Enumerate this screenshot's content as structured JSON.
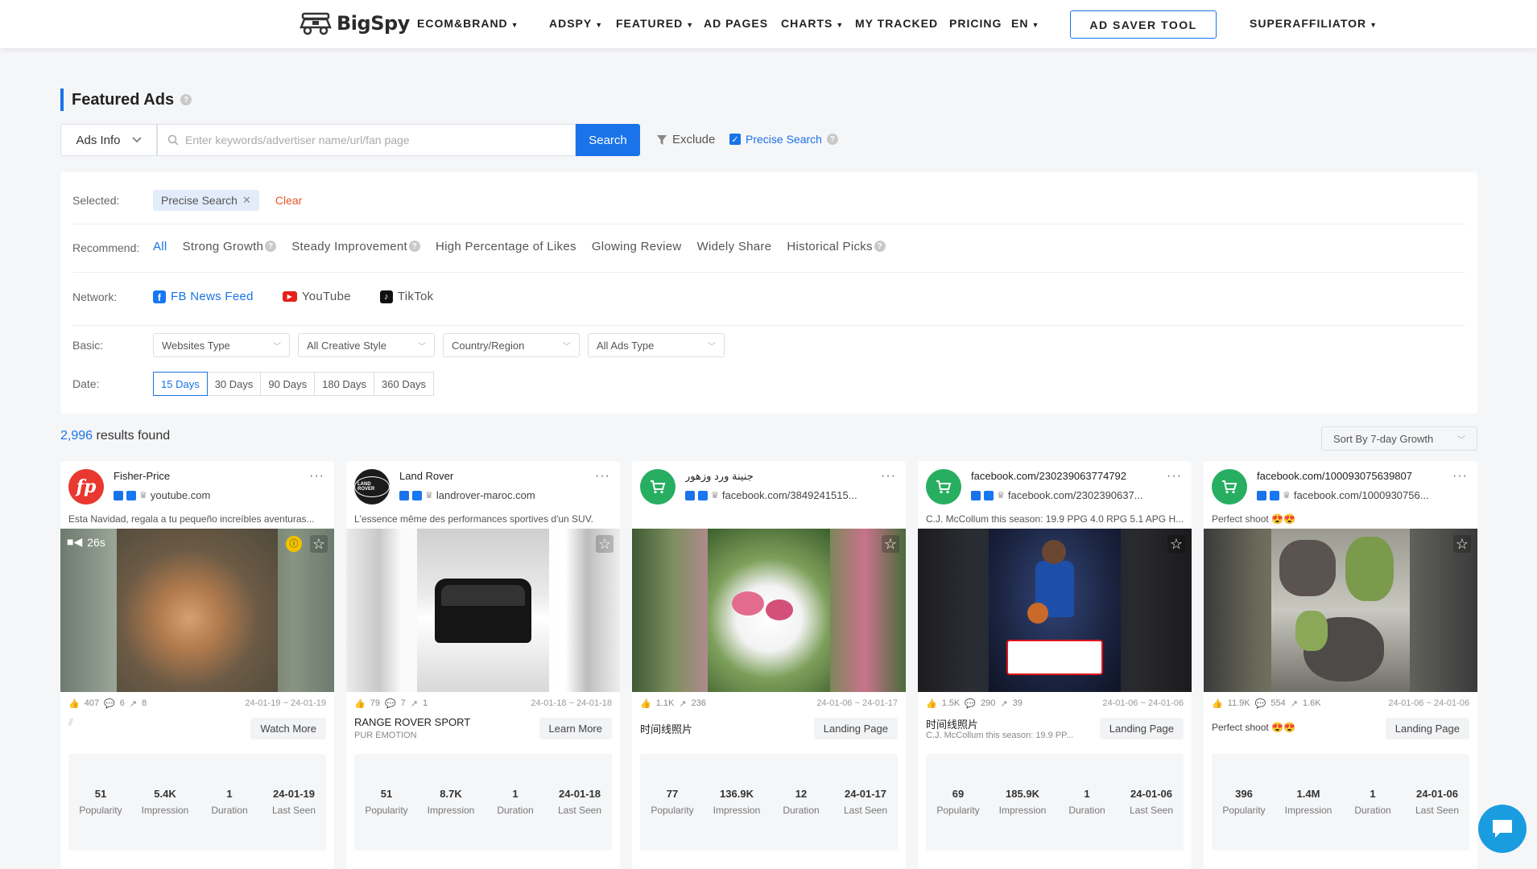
{
  "header": {
    "logo": "BigSpy",
    "nav": [
      {
        "label": "ECOM&BRAND",
        "caret": true
      },
      {
        "label": "ADSPY",
        "caret": true
      },
      {
        "label": "FEATURED",
        "caret": true
      },
      {
        "label": "AD PAGES",
        "caret": false
      },
      {
        "label": "CHARTS",
        "caret": true
      },
      {
        "label": "MY TRACKED",
        "caret": false
      },
      {
        "label": "PRICING",
        "caret": false
      },
      {
        "label": "EN",
        "caret": true
      },
      {
        "label": "SUPERAFFILIATOR",
        "caret": true
      }
    ],
    "saver_button": "AD SAVER TOOL"
  },
  "page": {
    "title": "Featured Ads"
  },
  "search": {
    "type_select": "Ads Info",
    "placeholder": "Enter keywords/advertiser name/url/fan page",
    "button": "Search",
    "exclude": "Exclude",
    "precise": "Precise Search"
  },
  "filters": {
    "selected_label": "Selected:",
    "selected_chip": "Precise Search",
    "clear": "Clear",
    "recommend_label": "Recommend:",
    "recommend": [
      "All",
      "Strong Growth",
      "Steady Improvement",
      "High Percentage of Likes",
      "Glowing Review",
      "Widely Share",
      "Historical Picks"
    ],
    "network_label": "Network:",
    "networks": [
      "FB News Feed",
      "YouTube",
      "TikTok"
    ],
    "basic_label": "Basic:",
    "basic": [
      "Websites Type",
      "All Creative Style",
      "Country/Region",
      "All Ads Type"
    ],
    "date_label": "Date:",
    "dates": [
      "15 Days",
      "30 Days",
      "90 Days",
      "180 Days",
      "360 Days"
    ]
  },
  "results": {
    "count": "2,996",
    "text": "results found",
    "sort": "Sort By 7-day Growth"
  },
  "cards": [
    {
      "name": "Fisher-Price",
      "domain": "youtube.com",
      "avatar_text": "fp",
      "avatar_color": "#e8382f",
      "desc": "Esta Navidad, regala a tu pequeño increíbles aventuras...",
      "video_duration": "26s",
      "likes": "407",
      "comments": "6",
      "shares": "8",
      "dates": "24-01-19 ~ 24-01-19",
      "headline": "",
      "sub": "",
      "cta": "Watch More",
      "metrics": {
        "popularity": "51",
        "impression": "5.4K",
        "duration": "1",
        "last_seen": "24-01-19"
      }
    },
    {
      "name": "Land Rover",
      "domain": "landrover-maroc.com",
      "avatar_text": "LAND ROVER",
      "avatar_color": "#1b1b1b",
      "desc": "L'essence même des performances sportives d'un SUV.",
      "likes": "79",
      "comments": "7",
      "shares": "1",
      "dates": "24-01-18 ~ 24-01-18",
      "headline": "RANGE ROVER SPORT",
      "sub": "PUR ÉMOTION",
      "cta": "Learn More",
      "metrics": {
        "popularity": "51",
        "impression": "8.7K",
        "duration": "1",
        "last_seen": "24-01-18"
      }
    },
    {
      "name": "جنينة ورد وزهور",
      "domain": "facebook.com/3849241515...",
      "avatar_text": "cart",
      "avatar_color": "#27ae60",
      "desc": "",
      "likes": "1.1K",
      "comments": "",
      "shares": "236",
      "dates": "24-01-06 ~ 24-01-17",
      "headline": "时间线照片",
      "sub": "",
      "cta": "Landing Page",
      "metrics": {
        "popularity": "77",
        "impression": "136.9K",
        "duration": "12",
        "last_seen": "24-01-17"
      }
    },
    {
      "name": "facebook.com/230239063774792",
      "domain": "facebook.com/2302390637...",
      "avatar_text": "cart",
      "avatar_color": "#27ae60",
      "desc": "C.J. McCollum this season: 19.9 PPG 4.0 RPG 5.1 APG H...",
      "likes": "1.5K",
      "comments": "290",
      "shares": "39",
      "dates": "24-01-06 ~ 24-01-06",
      "headline": "时间线照片",
      "sub": "C.J. McCollum this season: 19.9 PP...",
      "cta": "Landing Page",
      "metrics": {
        "popularity": "69",
        "impression": "185.9K",
        "duration": "1",
        "last_seen": "24-01-06"
      }
    },
    {
      "name": "facebook.com/100093075639807",
      "domain": "facebook.com/1000930756...",
      "avatar_text": "cart",
      "avatar_color": "#27ae60",
      "desc": "Perfect shoot 😍😍",
      "likes": "11.9K",
      "comments": "554",
      "shares": "1.6K",
      "dates": "24-01-06 ~ 24-01-06",
      "headline": "Perfect shoot 😍😍",
      "sub": "",
      "cta": "Landing Page",
      "metrics": {
        "popularity": "396",
        "impression": "1.4M",
        "duration": "1",
        "last_seen": "24-01-06"
      }
    }
  ],
  "metric_labels": {
    "popularity": "Popularity",
    "impression": "Impression",
    "duration": "Duration",
    "last_seen": "Last Seen"
  },
  "colors": {
    "accent": "#1a73e8",
    "clear": "#e8542a",
    "chat": "#1a9de0"
  }
}
